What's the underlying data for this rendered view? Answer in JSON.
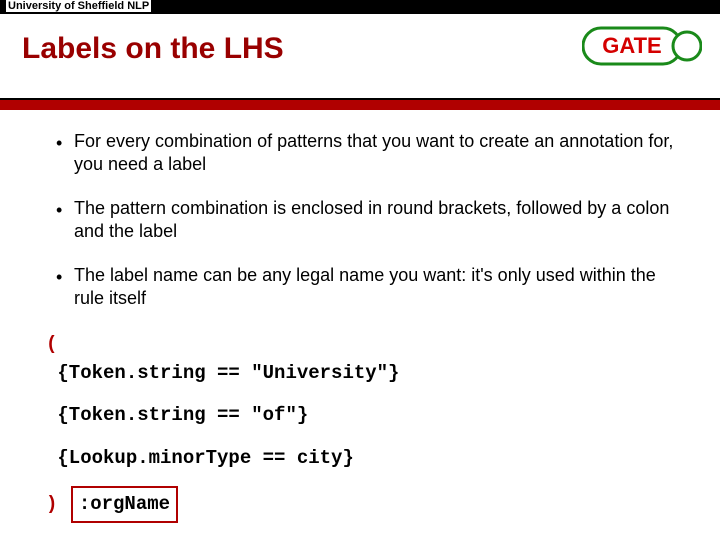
{
  "affiliation": "University of Sheffield NLP",
  "title": "Labels on the LHS",
  "logo": {
    "text": "GATE",
    "color_text": "#d40000",
    "color_border": "#1a8a1a"
  },
  "bullets": [
    "For every combination of patterns that you want to create an annotation for, you need a label",
    "The pattern combination is enclosed in round brackets, followed by a colon and the label",
    "The label name can be any legal name you want: it's only used within the rule itself"
  ],
  "code": {
    "open_paren": "(",
    "line1": "{Token.string == \"University\"}",
    "line2": "{Token.string == \"of\"}",
    "line3": "{Lookup.minorType == city}",
    "close_paren": ")",
    "label": ":orgName"
  }
}
